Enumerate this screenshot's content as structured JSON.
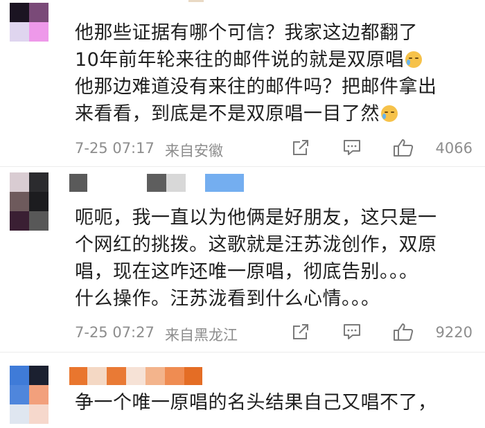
{
  "comments": [
    {
      "text_lines": [
        "他那些证据有哪个可信？我家这边都翻了",
        "10年前年轮来往的邮件说的就是双原唱",
        "他那边难道没有来往的邮件吗？把邮件拿出",
        "来看看，到底是不是双原唱一目了然"
      ],
      "time": "7-25 07:17",
      "location": "来自安徽",
      "likes": "4066",
      "emoji_icon": "crying-face-icon"
    },
    {
      "text_lines": [
        "呃呃，我一直以为他俩是好朋友，这只是一",
        "个网红的挑拨。这歌就是汪苏泷创作，双原",
        "唱，现在这咋还唯一原唱，彻底告别。。。",
        "什么操作。汪苏泷看到什么心情。。。"
      ],
      "time": "7-25 07:27",
      "location": "来自黑龙江",
      "likes": "9220"
    },
    {
      "text_lines": [
        "争一个唯一原唱的名头结果自己又唱不了，"
      ]
    }
  ],
  "icons": {
    "share": "share-icon",
    "reply": "comment-icon",
    "like": "thumbs-up-icon"
  },
  "colors": {
    "text": "#1f1f1f",
    "meta": "#8d8d8d",
    "icon": "#7a7a7a",
    "divider": "#ececec"
  }
}
